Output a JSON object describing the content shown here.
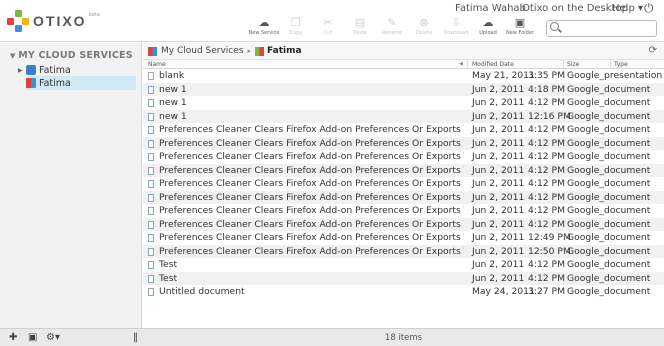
{
  "app": {
    "logo_text": "OTIXO",
    "logo_beta": "beta"
  },
  "user_menu": {
    "user_name": "Fatima Wahab",
    "desktop_link": "Otixo on the Desktop",
    "help": "Help ▾"
  },
  "toolbar": {
    "new_service": "New Service",
    "copy": "Copy",
    "cut": "Cut",
    "paste": "Paste",
    "rename": "Rename",
    "delete": "Delete",
    "download": "Download",
    "upload": "Upload",
    "new_folder": "New Folder"
  },
  "search": {
    "placeholder": ""
  },
  "sidebar": {
    "header": "MY CLOUD SERVICES",
    "items": [
      {
        "label": "Fatima"
      },
      {
        "label": "Fatima"
      }
    ]
  },
  "breadcrumb": {
    "root": "My Cloud Services",
    "current": "Fatima"
  },
  "columns": {
    "name": "Name",
    "date": "Modified Date",
    "size": "Size",
    "type": "Type"
  },
  "files": [
    {
      "name": "blank",
      "date": "May 21, 2011",
      "time": "3:35 PM",
      "type": "Google_presentation"
    },
    {
      "name": "new 1",
      "date": "Jun 2, 2011",
      "time": "4:18 PM",
      "type": "Google_document"
    },
    {
      "name": "new 1",
      "date": "Jun 2, 2011",
      "time": "4:12 PM",
      "type": "Google_document"
    },
    {
      "name": "new 1",
      "date": "Jun 2, 2011",
      "time": "12:16 PM",
      "type": "Google_document"
    },
    {
      "name": "Preferences Cleaner Clears Firefox Add-on Preferences Or Exports Them",
      "date": "Jun 2, 2011",
      "time": "4:12 PM",
      "type": "Google_document"
    },
    {
      "name": "Preferences Cleaner Clears Firefox Add-on Preferences Or Exports Them",
      "date": "Jun 2, 2011",
      "time": "4:12 PM",
      "type": "Google_document"
    },
    {
      "name": "Preferences Cleaner Clears Firefox Add-on Preferences Or Exports Them",
      "date": "Jun 2, 2011",
      "time": "4:12 PM",
      "type": "Google_document"
    },
    {
      "name": "Preferences Cleaner Clears Firefox Add-on Preferences Or Exports Them",
      "date": "Jun 2, 2011",
      "time": "4:12 PM",
      "type": "Google_document"
    },
    {
      "name": "Preferences Cleaner Clears Firefox Add-on Preferences Or Exports Them",
      "date": "Jun 2, 2011",
      "time": "4:12 PM",
      "type": "Google_document"
    },
    {
      "name": "Preferences Cleaner Clears Firefox Add-on Preferences Or Exports Them",
      "date": "Jun 2, 2011",
      "time": "4:12 PM",
      "type": "Google_document"
    },
    {
      "name": "Preferences Cleaner Clears Firefox Add-on Preferences Or Exports Them",
      "date": "Jun 2, 2011",
      "time": "4:12 PM",
      "type": "Google_document"
    },
    {
      "name": "Preferences Cleaner Clears Firefox Add-on Preferences Or Exports Them",
      "date": "Jun 2, 2011",
      "time": "4:12 PM",
      "type": "Google_document"
    },
    {
      "name": "Preferences Cleaner Clears Firefox Add-on Preferences Or Exports Them",
      "date": "Jun 2, 2011",
      "time": "12:49 PM",
      "type": "Google_document"
    },
    {
      "name": "Preferences Cleaner Clears Firefox Add-on Preferences Or Exports Them",
      "date": "Jun 2, 2011",
      "time": "12:50 PM",
      "type": "Google_document"
    },
    {
      "name": "Test",
      "date": "Jun 2, 2011",
      "time": "4:12 PM",
      "type": "Google_document"
    },
    {
      "name": "Test",
      "date": "Jun 2, 2011",
      "time": "4:12 PM",
      "type": "Google_document"
    },
    {
      "name": "Untitled document",
      "date": "May 24, 2011",
      "time": "3:27 PM",
      "type": "Google_document"
    }
  ],
  "status": {
    "items_count": "18 items"
  },
  "colors": {
    "selected": "#cfe9f5",
    "logo_red": "#e0413a",
    "logo_green": "#7bb740",
    "logo_blue": "#3a8fd8",
    "logo_yellow": "#f2b418"
  }
}
